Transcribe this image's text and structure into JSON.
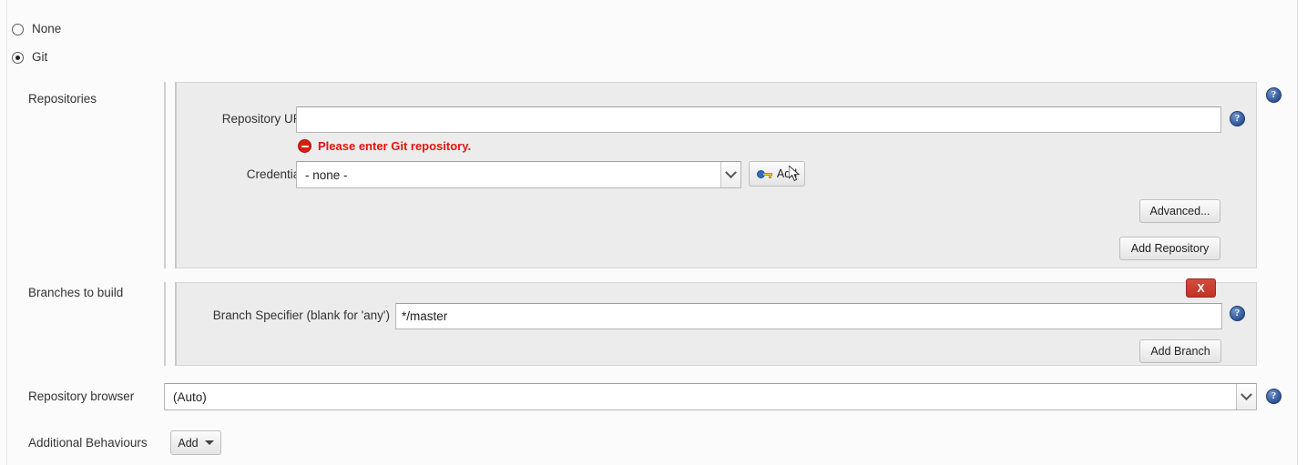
{
  "scm_options": [
    {
      "label": "None",
      "checked": false
    },
    {
      "label": "Git",
      "checked": true
    }
  ],
  "repositories": {
    "section_label": "Repositories",
    "repository_url": {
      "label": "Repository URL",
      "value": "",
      "placeholder": ""
    },
    "error": {
      "text": "Please enter Git repository.",
      "icon": "error-stop-icon",
      "color": "#e8120e"
    },
    "credentials": {
      "label": "Credentials",
      "selected": "- none -",
      "options": [
        "- none -"
      ]
    },
    "add_credentials_button": {
      "label": "Add",
      "icon": "key-icon"
    },
    "advanced_button": "Advanced...",
    "add_repository_button": "Add Repository",
    "help_icon": "help-icon"
  },
  "branches": {
    "section_label": "Branches to build",
    "branch_specifier": {
      "label": "Branch Specifier (blank for 'any')",
      "value": "*/master"
    },
    "delete_button": "X",
    "add_branch_button": "Add Branch",
    "help_icon": "help-icon"
  },
  "repository_browser": {
    "label": "Repository browser",
    "selected": "(Auto)",
    "options": [
      "(Auto)"
    ],
    "help_icon": "help-icon"
  },
  "additional_behaviours": {
    "label": "Additional Behaviours",
    "add_button": "Add",
    "caret": "chevron-down-icon"
  },
  "colors": {
    "panel_bg": "#ececec",
    "page_bg": "#fbfbfb",
    "error_red": "#e8120e",
    "delete_red": "#bf3427",
    "help_blue": "#2e5699"
  }
}
